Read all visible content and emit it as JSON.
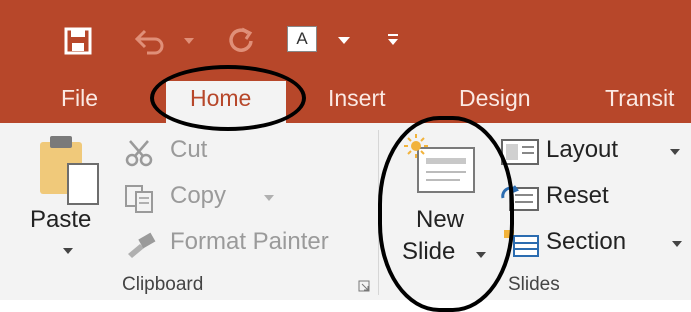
{
  "quick_access": {
    "font_box_letter": "A"
  },
  "tabs": [
    {
      "label": "File"
    },
    {
      "label": "Home"
    },
    {
      "label": "Insert"
    },
    {
      "label": "Design"
    },
    {
      "label": "Transit"
    }
  ],
  "clipboard": {
    "paste": "Paste",
    "cut": "Cut",
    "copy": "Copy",
    "format_painter": "Format Painter",
    "group_label": "Clipboard"
  },
  "slides": {
    "new_slide_line1": "New",
    "new_slide_line2": "Slide",
    "layout": "Layout",
    "reset": "Reset",
    "section": "Section",
    "group_label": "Slides"
  },
  "colors": {
    "title_bar": "#b7472a",
    "ribbon": "#f3f3f3",
    "highlight_circle": "#000000"
  }
}
